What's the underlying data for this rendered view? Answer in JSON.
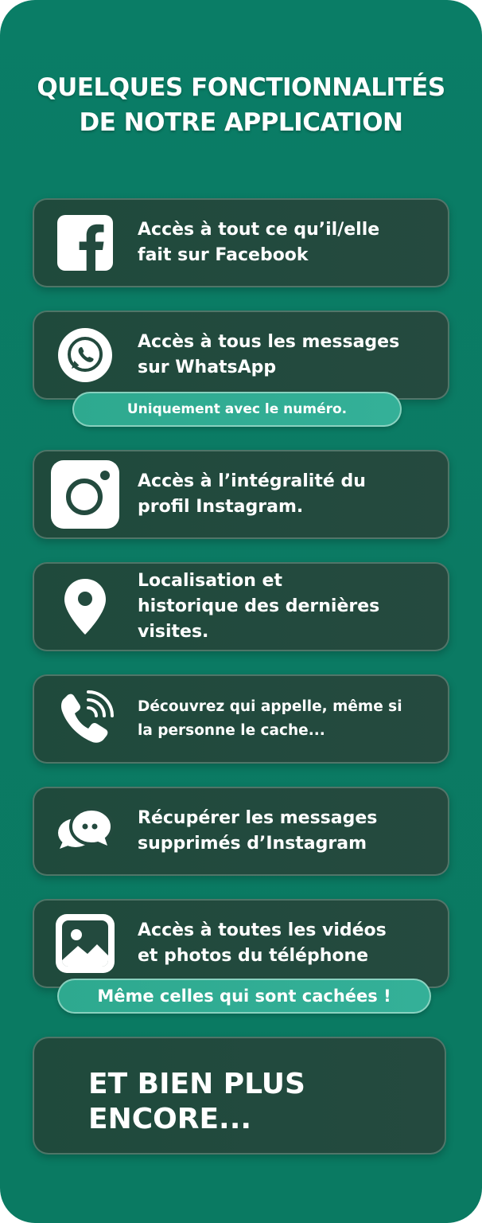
{
  "title": {
    "line1": "QUELQUES FONCTIONNALITÉS",
    "line2": "DE NOTRE APPLICATION"
  },
  "features": [
    {
      "icon": "facebook-icon",
      "line1": "Accès à tout ce qu’il/elle",
      "line2": "fait sur Facebook"
    },
    {
      "icon": "whatsapp-icon",
      "line1": "Accès à tous les messages",
      "line2": "sur WhatsApp",
      "note": "Uniquement avec le numéro."
    },
    {
      "icon": "instagram-icon",
      "line1": "Accès à l’intégralité du",
      "line2": "profil Instagram."
    },
    {
      "icon": "location-pin-icon",
      "line1": "Localisation et",
      "line2": "historique des dernières",
      "line3": "visites."
    },
    {
      "icon": "phone-call-icon",
      "line1": "Découvrez qui appelle, même si",
      "line2": "la personne le cache..."
    },
    {
      "icon": "chat-bubbles-icon",
      "line1": "Récupérer les messages",
      "line2": "supprimés d’Instagram"
    },
    {
      "icon": "image-icon",
      "line1": "Accès à toutes les vidéos",
      "line2": "et photos du téléphone",
      "note": "Même celles qui sont cachées !"
    }
  ],
  "more": {
    "line1": "ET BIEN PLUS",
    "line2": "ENCORE..."
  },
  "colors": {
    "background": "#0a7d66",
    "card": "#234a3e",
    "pill": "#2ea98f",
    "text": "#ffffff"
  }
}
